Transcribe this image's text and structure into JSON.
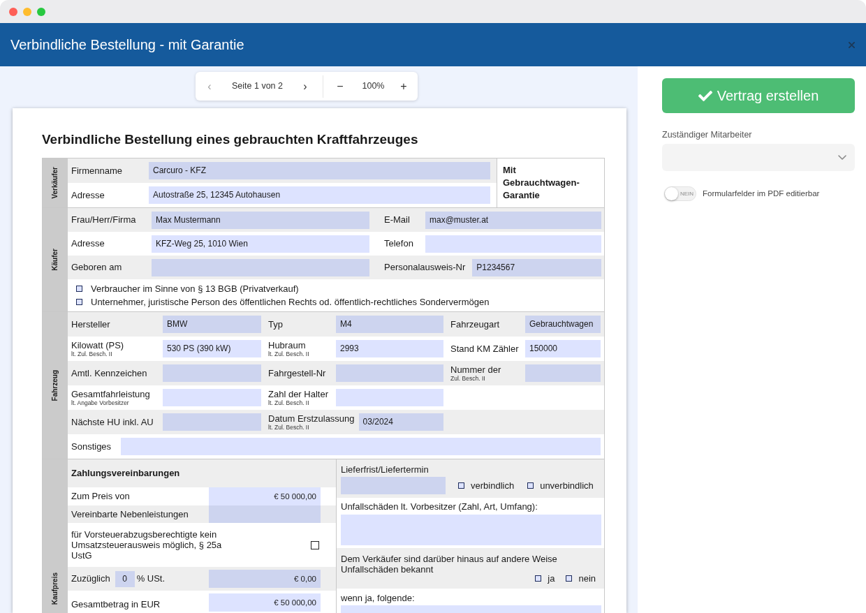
{
  "window": {
    "title": "Verbindliche Bestellung - mit Garantie"
  },
  "viewer_toolbar": {
    "previous": {
      "label": "‹",
      "disabled": true
    },
    "page": "Seite 1 von 2",
    "next": {
      "label": "›",
      "disabled": false
    },
    "zoom_out": "−",
    "zoom": "100%",
    "zoom_in": "+"
  },
  "document": {
    "title": "Verbindliche Bestellung eines gebrauchten Kraftfahrzeuges",
    "seller": {
      "side_label": "Verkäufer",
      "rows": [
        {
          "label": "Firmenname",
          "value": "Carcuro - KFZ"
        },
        {
          "label": "Adresse",
          "value": "Autostraße 25, 12345 Autohausen"
        }
      ],
      "badge": "Mit Gebrauchtwagen-Garantie"
    },
    "buyer": {
      "side_label": "Käufer",
      "rows": [
        [
          {
            "label": "Frau/Herr/Firma",
            "value": "Max Mustermann"
          },
          {
            "label": "E-Mail",
            "value": "max@muster.at"
          }
        ],
        [
          {
            "label": "Adresse",
            "value": "KFZ-Weg 25, 1010 Wien"
          },
          {
            "label": "Telefon"
          }
        ],
        [
          {
            "label": "Geboren am"
          },
          {
            "label": "Personalausweis-Nr",
            "value": "P1234567"
          }
        ]
      ],
      "options": [
        {
          "label": "Verbraucher im Sinne von § 13 BGB (Privatverkauf)",
          "checked": false
        },
        {
          "label": "Unternehmer, juristische Person des öffentlichen Rechts od. öffentlich-rechtliches Sondervermögen",
          "checked": false
        }
      ]
    },
    "vehicle": {
      "side_label": "Fahrzeug",
      "rows": [
        [
          {
            "label": "Hersteller",
            "value": "BMW"
          },
          {
            "label": "Typ",
            "value": "M4"
          },
          {
            "label": "Fahrzeugart",
            "value": "Gebrauchtwagen"
          }
        ],
        [
          {
            "label": "Kilowatt (PS)",
            "note": "lt. Zul. Besch. II",
            "value": "530 PS (390 kW)"
          },
          {
            "label": "Hubraum",
            "note": "lt. Zul. Besch. II",
            "value": "2993"
          },
          {
            "label": "Stand KM Zähler",
            "value": "150000"
          }
        ],
        [
          {
            "label": "Amtl. Kennzeichen"
          },
          {
            "label": "Fahrgestell-Nr"
          },
          {
            "label": "Nummer der",
            "note": "Zul. Besch. II"
          }
        ],
        [
          {
            "label": "Gesamtfahrleistung",
            "note": "lt. Angabe Vorbesitzer"
          },
          {
            "label": "Zahl der Halter",
            "note": "lt. Zul. Besch. II"
          }
        ],
        [
          {
            "label": "Nächste HU inkl. AU"
          },
          {
            "label": "Datum Erstzulassung",
            "note": "lt. Zul. Besch. II",
            "value": "03/2024"
          }
        ]
      ],
      "remarks": {
        "label": "Sonstiges"
      }
    },
    "purchase": {
      "side_label": "Kaufpreis",
      "payment": {
        "heading": "Zahlungsvereinbarungen",
        "price_rows": [
          {
            "label": "Zum Preis von",
            "value": "€ 50 000,00"
          },
          {
            "label": "Vereinbarte Nebenleistungen"
          }
        ],
        "input_tax_note": {
          "label": "für Vorsteuerabzugsberechtigte kein Umsatzsteuerausweis möglich, § 25a UstG",
          "checked": false
        },
        "vat": {
          "label": "Zuzüglich",
          "rate": "0",
          "unit": "% USt.",
          "value": "€ 0,00"
        },
        "total": {
          "label": "Gesamtbetrag in EUR",
          "value": "€ 50 000,00"
        }
      },
      "delivery": {
        "label": "Lieferfrist/Liefertermin",
        "options": [
          {
            "label": "verbindlich",
            "checked": false
          },
          {
            "label": "unverbindlich",
            "checked": false
          }
        ]
      },
      "prior_damage": {
        "label": "Unfallschäden lt. Vorbesitzer (Zahl, Art, Umfang):"
      },
      "known_damage": {
        "label": "Dem Verkäufer sind darüber hinaus auf andere Weise Unfallschäden bekannt",
        "options": [
          {
            "label": "ja",
            "checked": false
          },
          {
            "label": "nein",
            "checked": false
          }
        ]
      },
      "damage_details": {
        "label": "wenn ja, folgende:"
      }
    }
  },
  "side_panel": {
    "create_button": "Vertrag erstellen",
    "employee_select": {
      "label": "Zuständiger Mitarbeiter"
    },
    "toggle": {
      "label": "Formularfelder im PDF editierbar",
      "on": false,
      "state_text": "NEIN"
    }
  }
}
